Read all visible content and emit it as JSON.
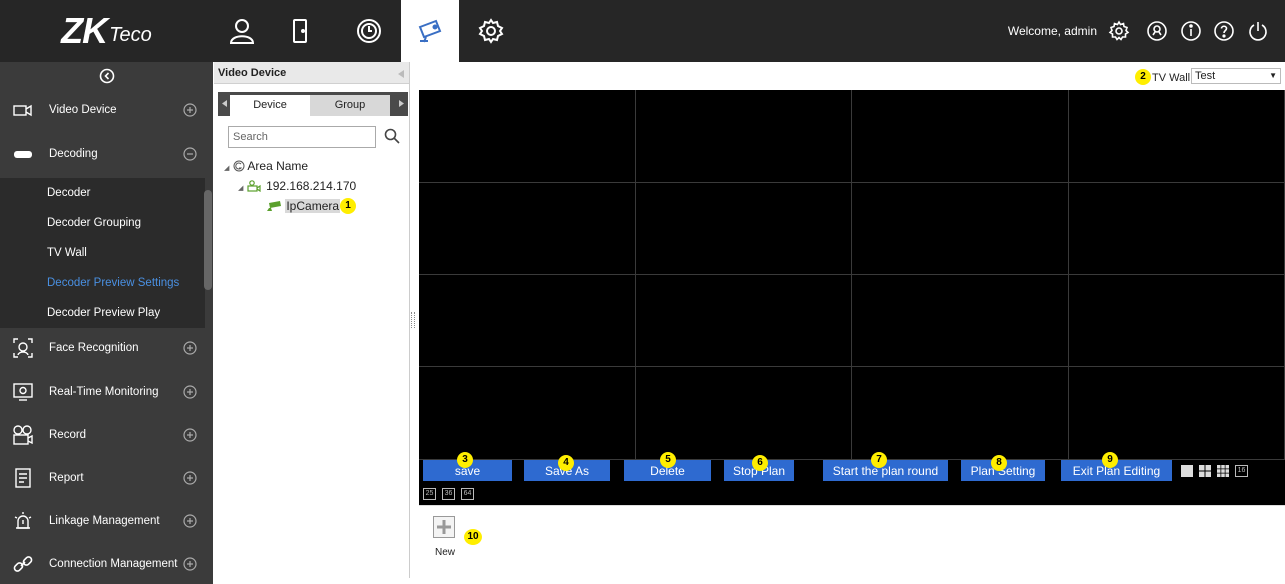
{
  "logo": {
    "zk": "ZK",
    "teco": "Teco"
  },
  "header": {
    "welcome": "Welcome, admin"
  },
  "sidebar": {
    "items": [
      {
        "label": "Video Device",
        "icon": "camera-icon",
        "toggle": "plus"
      },
      {
        "label": "Decoding",
        "icon": "decoder-icon",
        "toggle": "minus"
      },
      {
        "label": "Face Recognition",
        "icon": "face-icon",
        "toggle": "plus"
      },
      {
        "label": "Real-Time Monitoring",
        "icon": "monitor-icon",
        "toggle": "plus"
      },
      {
        "label": "Record",
        "icon": "record-icon",
        "toggle": "plus"
      },
      {
        "label": "Report",
        "icon": "report-icon",
        "toggle": "plus"
      },
      {
        "label": "Linkage Management",
        "icon": "alarm-icon",
        "toggle": "plus"
      },
      {
        "label": "Connection Management",
        "icon": "link-icon",
        "toggle": "plus"
      }
    ],
    "subitems": [
      {
        "label": "Decoder"
      },
      {
        "label": "Decoder Grouping"
      },
      {
        "label": "TV Wall"
      },
      {
        "label": "Decoder Preview Settings",
        "active": true
      },
      {
        "label": "Decoder Preview Play"
      }
    ]
  },
  "device_panel": {
    "title": "Video Device",
    "tabs": [
      "Device",
      "Group"
    ],
    "search_placeholder": "Search",
    "tree": {
      "root": "Area Name",
      "device": "192.168.214.170",
      "camera": "IpCamera"
    }
  },
  "tv_wall": {
    "label": "TV Wall",
    "selected": "Test"
  },
  "toolbar": {
    "buttons": [
      "save",
      "Save As",
      "Delete",
      "Stop Plan",
      "Start the plan round",
      "Plan Setting",
      "Exit Plan Editing"
    ],
    "layout_numbers": [
      "25",
      "36",
      "64"
    ]
  },
  "new_label": "New",
  "badges": [
    "1",
    "2",
    "3",
    "4",
    "5",
    "6",
    "7",
    "8",
    "9",
    "10"
  ]
}
